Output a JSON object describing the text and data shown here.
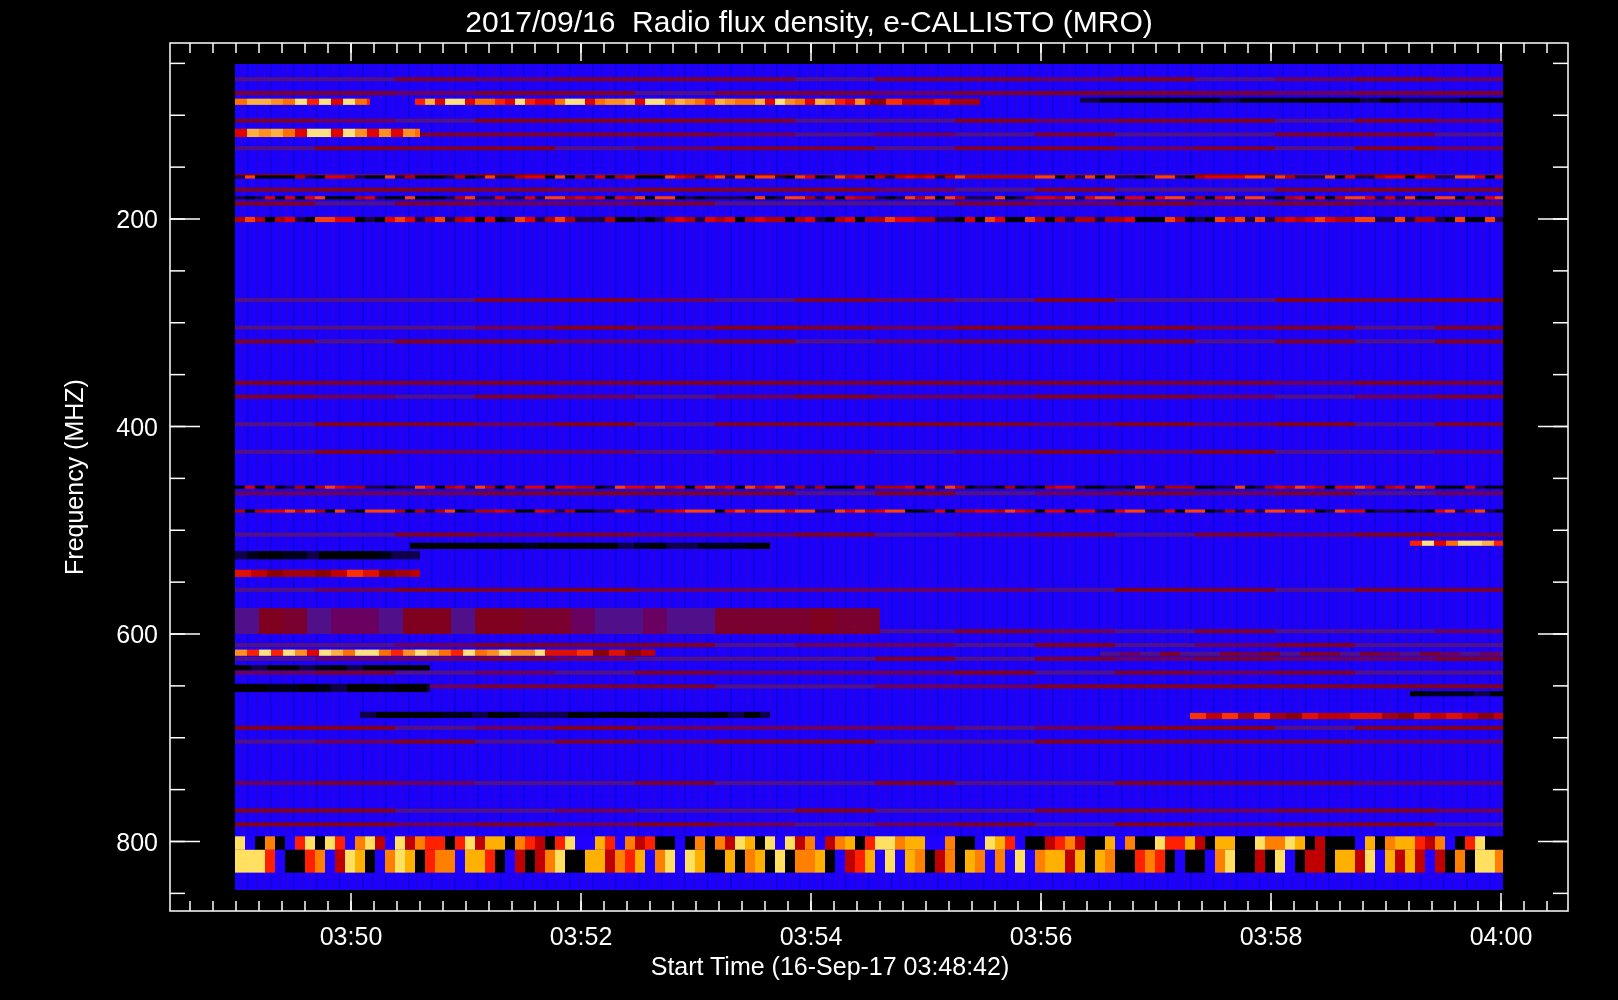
{
  "title": "2017/09/16  Radio flux density, e-CALLISTO (MRO)",
  "y_axis": {
    "label": "Frequency (MHZ)",
    "ticks": [
      "200",
      "400",
      "600",
      "800"
    ]
  },
  "x_axis": {
    "label": "Start Time (16-Sep-17 03:48:42)",
    "ticks": [
      "03:50",
      "03:52",
      "03:54",
      "03:56",
      "03:58",
      "04:00"
    ]
  }
}
